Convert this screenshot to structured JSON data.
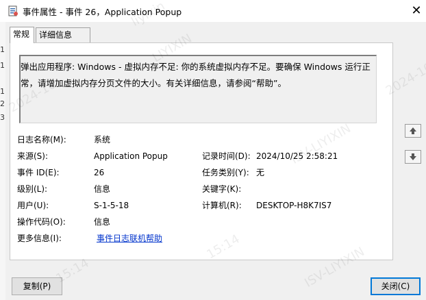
{
  "window": {
    "title": "事件属性 - 事件 26，Application Popup",
    "close_glyph": "✕"
  },
  "tabs": [
    {
      "label": "常规"
    },
    {
      "label": "详细信息"
    }
  ],
  "message": "弹出应用程序: Windows - 虚拟内存不足: 你的系统虚拟内存不足。要确保 Windows 运行正常，请增加虚拟内存分页文件的大小。有关详细信息，请参阅“帮助”。",
  "fields": {
    "log_name": {
      "label": "日志名称(M):",
      "value": "系统"
    },
    "source": {
      "label": "来源(S):",
      "value": "Application Popup"
    },
    "logged": {
      "label": "记录时间(D):",
      "value": "2024/10/25 2:58:21"
    },
    "event_id": {
      "label": "事件 ID(E):",
      "value": "26"
    },
    "task_category": {
      "label": "任务类别(Y):",
      "value": "无"
    },
    "level": {
      "label": "级别(L):",
      "value": "信息"
    },
    "keywords": {
      "label": "关键字(K):",
      "value": ""
    },
    "user": {
      "label": "用户(U):",
      "value": "S-1-5-18"
    },
    "computer": {
      "label": "计算机(R):",
      "value": "DESKTOP-H8K7IS7"
    },
    "opcode": {
      "label": "操作代码(O):",
      "value": "信息"
    },
    "more_info": {
      "label": "更多信息(I):",
      "link": "事件日志联机帮助"
    }
  },
  "buttons": {
    "copy": "复制(P)",
    "close": "关闭(C)"
  },
  "left_edge_digits": [
    "1",
    "1",
    "1",
    "2",
    "3"
  ],
  "watermarks": [
    "liyixin",
    "2024-10",
    "ISV-LIYIXIN",
    "15:14",
    "ISV-LIYIXIN",
    "2024-10",
    "LIYIXIN",
    "15:14"
  ],
  "icons": {
    "app": "event-properties-icon",
    "up": "arrow-up-icon",
    "down": "arrow-down-icon"
  },
  "colors": {
    "link": "#0033cc",
    "focus_border": "#0078d7"
  }
}
